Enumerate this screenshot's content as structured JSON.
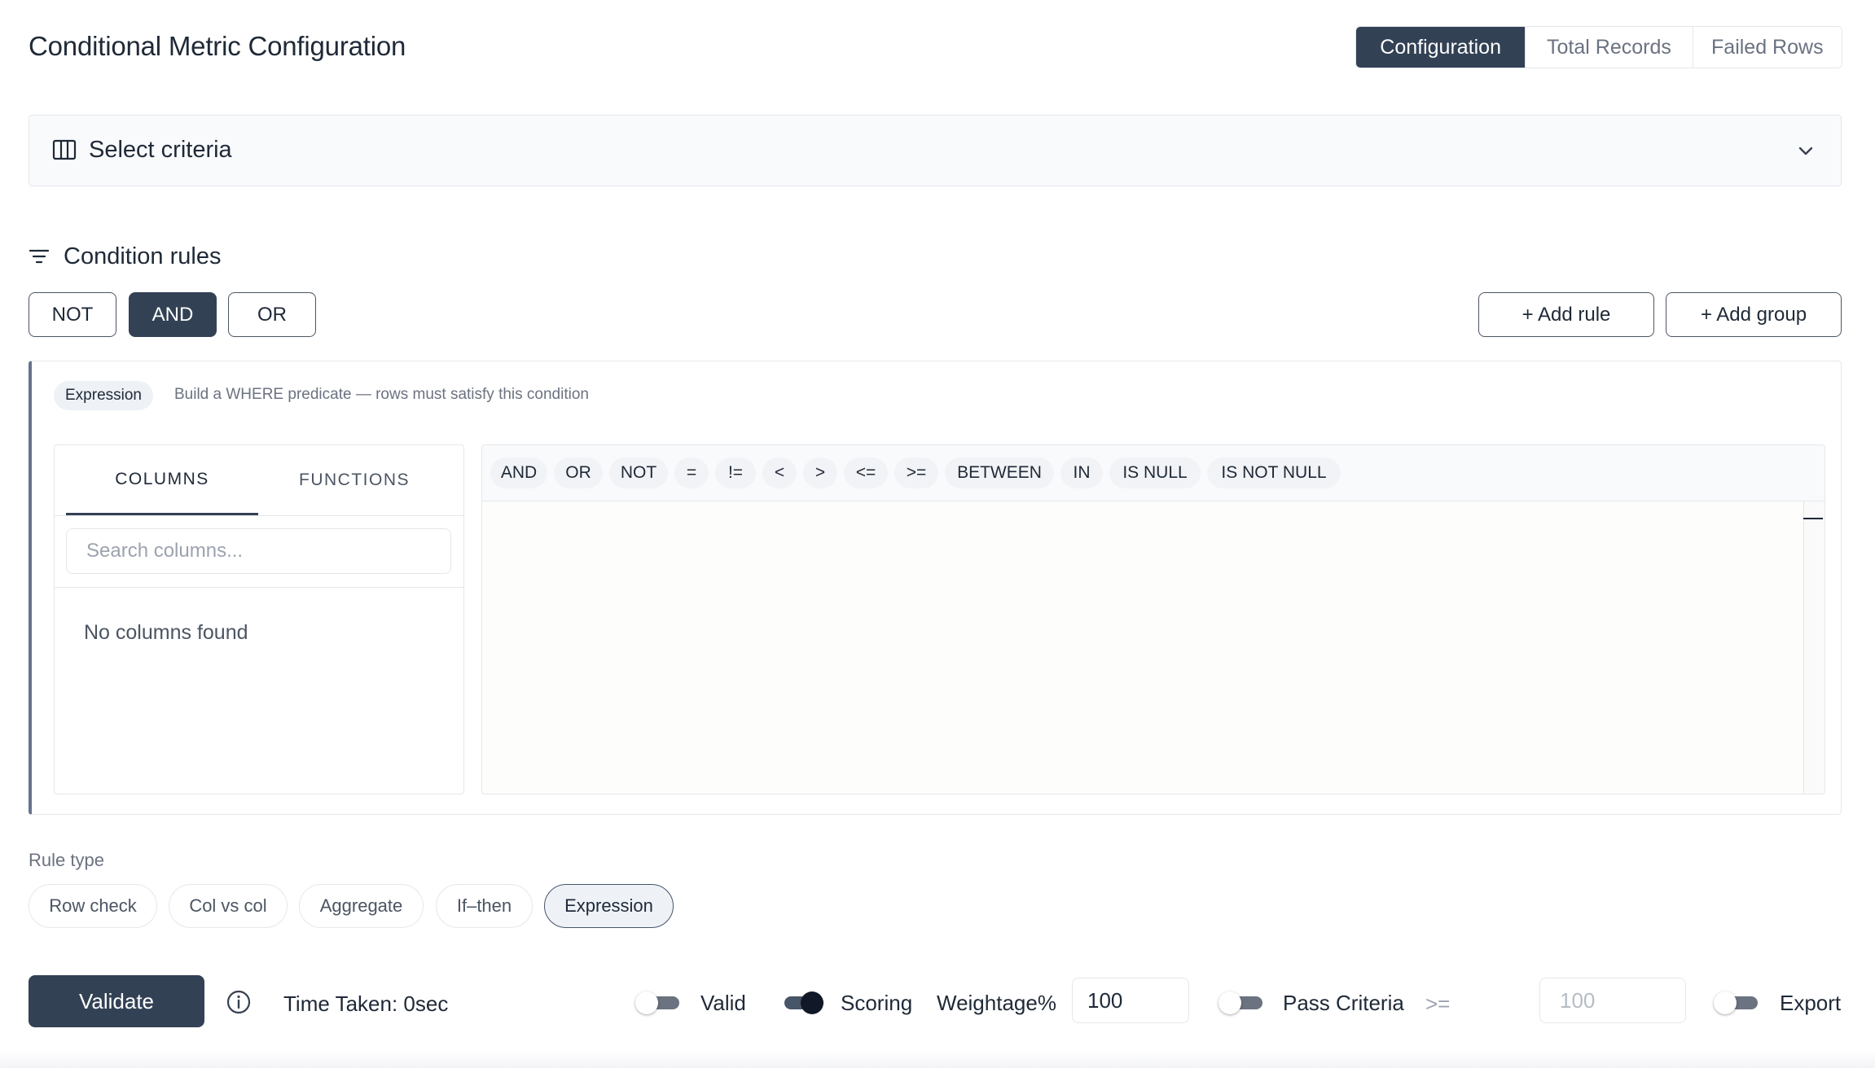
{
  "header": {
    "title": "Conditional Metric Configuration",
    "tabs": [
      {
        "label": "Configuration",
        "active": true
      },
      {
        "label": "Total Records",
        "active": false
      },
      {
        "label": "Failed Rows",
        "active": false
      }
    ]
  },
  "criteria": {
    "icon": "columns-icon",
    "label": "Select criteria",
    "toggle_icon": "chevron-down-icon"
  },
  "conditions": {
    "icon": "filter-icon",
    "title": "Condition rules",
    "logic_buttons": [
      {
        "label": "NOT",
        "active": false
      },
      {
        "label": "AND",
        "active": true
      },
      {
        "label": "OR",
        "active": false
      }
    ],
    "add_rule_label": "+ Add rule",
    "add_group_label": "+ Add group"
  },
  "expression": {
    "badge": "Expression",
    "hint": "Build a WHERE predicate — rows must satisfy this condition",
    "columns_tab": "COLUMNS",
    "functions_tab": "FUNCTIONS",
    "search_placeholder": "Search columns...",
    "search_value": "",
    "empty_message": "No columns found",
    "operators": [
      "AND",
      "OR",
      "NOT",
      "=",
      "!=",
      "<",
      ">",
      "<=",
      ">=",
      "BETWEEN",
      "IN",
      "IS NULL",
      "IS NOT NULL"
    ],
    "editor_value": ""
  },
  "rule_type": {
    "label": "Rule type",
    "options": [
      {
        "label": "Row check",
        "active": false
      },
      {
        "label": "Col vs col",
        "active": false
      },
      {
        "label": "Aggregate",
        "active": false
      },
      {
        "label": "If–then",
        "active": false
      },
      {
        "label": "Expression",
        "active": true
      }
    ]
  },
  "footer": {
    "validate_label": "Validate",
    "info_icon": "info-icon",
    "time_taken": "Time Taken: 0sec",
    "valid_label": "Valid",
    "valid_on": false,
    "scoring_label": "Scoring",
    "scoring_on": true,
    "weightage_label": "Weightage%",
    "weightage_value": "100",
    "pass_criteria_label": "Pass Criteria",
    "pass_criteria_on": false,
    "pass_operator": ">=",
    "pass_placeholder": "100",
    "export_label": "Export",
    "export_on": false
  },
  "colors": {
    "accent": "#334155",
    "border": "#e5e7eb",
    "muted_text": "#6b7280"
  }
}
